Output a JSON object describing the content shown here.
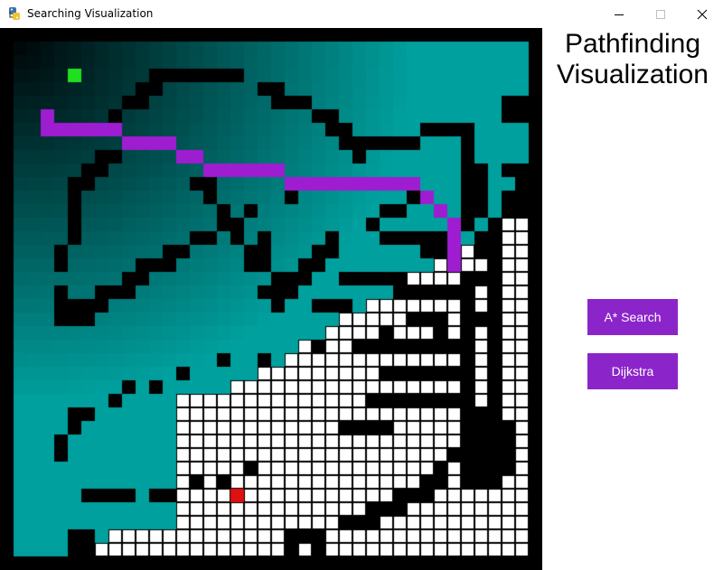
{
  "window": {
    "title": "Searching Visualization",
    "icon": "python-snake-icon",
    "controls": [
      "minimize",
      "maximize",
      "close"
    ]
  },
  "panel": {
    "title_line1": "Pathfinding",
    "title_line2": "Visualization",
    "buttons": [
      {
        "label": "A* Search"
      },
      {
        "label": "Dijkstra"
      }
    ]
  },
  "grid": {
    "rows": 39,
    "cols": 39,
    "start": [
      2,
      4
    ],
    "end": [
      33,
      16
    ],
    "colors": {
      "wall": "#000000",
      "open": "#ffffff",
      "cell_line": "#000000",
      "path": "#9E1DD1",
      "start": "#1FE01F",
      "end": "#E01010",
      "visited_dark": "#000000",
      "visited_light": "#00A09E",
      "accent_button": "#8B25C9"
    },
    "path": [
      [
        2,
        5
      ],
      [
        2,
        6
      ],
      [
        3,
        6
      ],
      [
        4,
        6
      ],
      [
        5,
        6
      ],
      [
        6,
        6
      ],
      [
        7,
        6
      ],
      [
        8,
        7
      ],
      [
        9,
        7
      ],
      [
        10,
        7
      ],
      [
        11,
        7
      ],
      [
        12,
        8
      ],
      [
        13,
        8
      ],
      [
        14,
        9
      ],
      [
        15,
        9
      ],
      [
        16,
        9
      ],
      [
        17,
        9
      ],
      [
        18,
        9
      ],
      [
        19,
        9
      ],
      [
        20,
        10
      ],
      [
        21,
        10
      ],
      [
        22,
        10
      ],
      [
        23,
        10
      ],
      [
        24,
        10
      ],
      [
        25,
        10
      ],
      [
        26,
        10
      ],
      [
        27,
        10
      ],
      [
        28,
        10
      ],
      [
        29,
        10
      ],
      [
        30,
        11
      ],
      [
        31,
        12
      ],
      [
        32,
        13
      ],
      [
        32,
        14
      ],
      [
        32,
        15
      ],
      [
        32,
        16
      ]
    ],
    "walls": [
      [
        3,
        15
      ],
      [
        3,
        16
      ],
      [
        3,
        18
      ],
      [
        3,
        19
      ],
      [
        3,
        20
      ],
      [
        3,
        29
      ],
      [
        3,
        30
      ],
      [
        4,
        10
      ],
      [
        4,
        11
      ],
      [
        4,
        12
      ],
      [
        4,
        13
      ],
      [
        4,
        14
      ],
      [
        4,
        19
      ],
      [
        4,
        20
      ],
      [
        4,
        27
      ],
      [
        4,
        28
      ],
      [
        5,
        9
      ],
      [
        5,
        10
      ],
      [
        5,
        19
      ],
      [
        5,
        20
      ],
      [
        5,
        27
      ],
      [
        5,
        33
      ],
      [
        6,
        8
      ],
      [
        6,
        9
      ],
      [
        6,
        18
      ],
      [
        6,
        19
      ],
      [
        6,
        33
      ],
      [
        7,
        5
      ],
      [
        7,
        8
      ],
      [
        7,
        18
      ],
      [
        7,
        26
      ],
      [
        7,
        33
      ],
      [
        8,
        4
      ],
      [
        8,
        17
      ],
      [
        8,
        18
      ],
      [
        8,
        25
      ],
      [
        8,
        33
      ],
      [
        9,
        3
      ],
      [
        9,
        4
      ],
      [
        9,
        16
      ],
      [
        9,
        17
      ],
      [
        10,
        2
      ],
      [
        10,
        3
      ],
      [
        10,
        16
      ],
      [
        10,
        25
      ],
      [
        10,
        33
      ],
      [
        11,
        2
      ],
      [
        11,
        15
      ],
      [
        11,
        16
      ],
      [
        11,
        33
      ],
      [
        12,
        2
      ],
      [
        12,
        15
      ],
      [
        12,
        24
      ],
      [
        13,
        2
      ],
      [
        13,
        10
      ],
      [
        13,
        14
      ],
      [
        13,
        32
      ],
      [
        14,
        2
      ],
      [
        14,
        10
      ],
      [
        14,
        11
      ],
      [
        14,
        14
      ],
      [
        15,
        2
      ],
      [
        15,
        12
      ],
      [
        15,
        13
      ],
      [
        15,
        23
      ],
      [
        15,
        32
      ],
      [
        16,
        2
      ],
      [
        16,
        13
      ],
      [
        16,
        14
      ],
      [
        17,
        12
      ],
      [
        17,
        15
      ],
      [
        17,
        16
      ],
      [
        17,
        31
      ],
      [
        18,
        3
      ],
      [
        18,
        14
      ],
      [
        18,
        15
      ],
      [
        18,
        16
      ],
      [
        18,
        18
      ],
      [
        18,
        23
      ],
      [
        19,
        3
      ],
      [
        19,
        4
      ],
      [
        19,
        17
      ],
      [
        19,
        18
      ],
      [
        19,
        19
      ],
      [
        20,
        4
      ],
      [
        20,
        11
      ],
      [
        20,
        17
      ],
      [
        20,
        18
      ],
      [
        21,
        4
      ],
      [
        21,
        16
      ],
      [
        21,
        17
      ],
      [
        22,
        5
      ],
      [
        22,
        15
      ],
      [
        22,
        16
      ],
      [
        22,
        22
      ],
      [
        23,
        5
      ],
      [
        23,
        6
      ],
      [
        23,
        14
      ],
      [
        23,
        15
      ],
      [
        24,
        6
      ],
      [
        24,
        7
      ],
      [
        25,
        7
      ],
      [
        25,
        8
      ],
      [
        26,
        7
      ],
      [
        26,
        13
      ],
      [
        27,
        7
      ],
      [
        27,
        12
      ],
      [
        28,
        7
      ],
      [
        28,
        12
      ],
      [
        29,
        7
      ],
      [
        29,
        11
      ],
      [
        30,
        6
      ],
      [
        30,
        11
      ],
      [
        31,
        6
      ],
      [
        31,
        12
      ],
      [
        32,
        6
      ],
      [
        32,
        13
      ],
      [
        33,
        6
      ],
      [
        33,
        7
      ],
      [
        33,
        8
      ],
      [
        33,
        9
      ],
      [
        33,
        10
      ],
      [
        33,
        11
      ],
      [
        33,
        12
      ],
      [
        33,
        13
      ],
      [
        33,
        17
      ],
      [
        33,
        18
      ],
      [
        33,
        19
      ],
      [
        33,
        20
      ],
      [
        33,
        21
      ],
      [
        33,
        22
      ],
      [
        33,
        23
      ],
      [
        33,
        24
      ],
      [
        33,
        25
      ],
      [
        33,
        26
      ],
      [
        33,
        27
      ],
      [
        33,
        28
      ],
      [
        33,
        29
      ],
      [
        33,
        30
      ],
      [
        33,
        31
      ],
      [
        33,
        32
      ],
      [
        34,
        9
      ],
      [
        34,
        10
      ],
      [
        34,
        11
      ],
      [
        34,
        12
      ],
      [
        34,
        14
      ],
      [
        34,
        15
      ],
      [
        34,
        17
      ],
      [
        34,
        20
      ],
      [
        34,
        27
      ],
      [
        34,
        28
      ],
      [
        34,
        29
      ],
      [
        34,
        30
      ],
      [
        34,
        31
      ],
      [
        34,
        32
      ],
      [
        35,
        13
      ],
      [
        35,
        14
      ],
      [
        35,
        15
      ],
      [
        35,
        16
      ],
      [
        35,
        17
      ],
      [
        35,
        18
      ],
      [
        35,
        19
      ],
      [
        35,
        20
      ],
      [
        35,
        21
      ],
      [
        35,
        22
      ],
      [
        35,
        23
      ],
      [
        35,
        24
      ],
      [
        35,
        25
      ],
      [
        35,
        26
      ],
      [
        35,
        27
      ],
      [
        35,
        28
      ],
      [
        35,
        29
      ],
      [
        35,
        30
      ],
      [
        35,
        31
      ],
      [
        35,
        32
      ],
      [
        36,
        4
      ],
      [
        36,
        5
      ],
      [
        36,
        9
      ],
      [
        36,
        11
      ],
      [
        36,
        12
      ],
      [
        36,
        28
      ],
      [
        36,
        29
      ],
      [
        36,
        30
      ],
      [
        36,
        31
      ],
      [
        37,
        4
      ],
      [
        37,
        5
      ],
      [
        37,
        9
      ],
      [
        37,
        10
      ],
      [
        37,
        11
      ],
      [
        37,
        12
      ]
    ],
    "open_extra_walls": [
      [
        20,
        36
      ],
      [
        20,
        37
      ],
      [
        21,
        36
      ],
      [
        22,
        36
      ],
      [
        22,
        37
      ],
      [
        24,
        35
      ],
      [
        25,
        35
      ],
      [
        26,
        34
      ],
      [
        26,
        35
      ],
      [
        27,
        34
      ],
      [
        28,
        33
      ],
      [
        28,
        34
      ],
      [
        29,
        33
      ],
      [
        30,
        32
      ],
      [
        30,
        33
      ],
      [
        31,
        31
      ],
      [
        31,
        32
      ],
      [
        32,
        30
      ],
      [
        25,
        22
      ],
      [
        26,
        22
      ],
      [
        27,
        22
      ],
      [
        28,
        22
      ],
      [
        29,
        22
      ],
      [
        30,
        22
      ],
      [
        31,
        22
      ],
      [
        32,
        22
      ],
      [
        26,
        26
      ],
      [
        27,
        26
      ],
      [
        28,
        26
      ],
      [
        29,
        26
      ],
      [
        30,
        26
      ],
      [
        31,
        26
      ],
      [
        32,
        26
      ],
      [
        27,
        21
      ],
      [
        31,
        21
      ],
      [
        24,
        28
      ],
      [
        25,
        28
      ],
      [
        26,
        28
      ],
      [
        27,
        28
      ],
      [
        27,
        24
      ],
      [
        28,
        24
      ],
      [
        29,
        24
      ],
      [
        30,
        24
      ],
      [
        31,
        24
      ],
      [
        32,
        24
      ],
      [
        28,
        18
      ],
      [
        29,
        18
      ],
      [
        30,
        18
      ],
      [
        31,
        18
      ],
      [
        32,
        18
      ],
      [
        29,
        20
      ],
      [
        30,
        20
      ],
      [
        31,
        20
      ],
      [
        24,
        17
      ],
      [
        25,
        17
      ],
      [
        26,
        17
      ],
      [
        27,
        17
      ],
      [
        28,
        17
      ],
      [
        30,
        15
      ],
      [
        31,
        15
      ],
      [
        27,
        14
      ],
      [
        28,
        14
      ],
      [
        29,
        14
      ],
      [
        30,
        14
      ],
      [
        31,
        14
      ],
      [
        26,
        17
      ],
      [
        22,
        19
      ],
      [
        23,
        19
      ],
      [
        24,
        19
      ]
    ]
  }
}
